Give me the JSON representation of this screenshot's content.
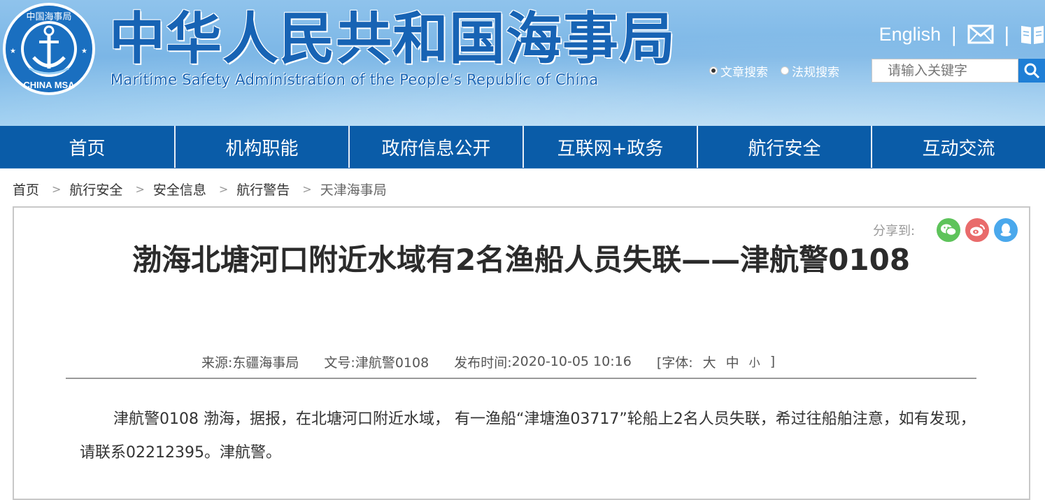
{
  "header": {
    "logo_text_top": "中国海事局",
    "logo_text_bottom": "CHINA MSA",
    "title_cn": "中华人民共和国海事局",
    "title_en": "Maritime Safety Administration of the People's Republic of China",
    "english_link": "English",
    "icons": [
      "mail-icon",
      "book-icon"
    ],
    "search_options": [
      {
        "label": "文章搜索",
        "selected": true
      },
      {
        "label": "法规搜索",
        "selected": false
      }
    ],
    "search_placeholder": "请输入关键字"
  },
  "nav": {
    "items": [
      "首页",
      "机构职能",
      "政府信息公开",
      "互联网+政务",
      "航行安全",
      "互动交流"
    ]
  },
  "breadcrumb": {
    "items": [
      "首页",
      "航行安全",
      "安全信息",
      "航行警告",
      "天津海事局"
    ],
    "separator": ">"
  },
  "article": {
    "share_label": "分享到:",
    "share_icons": [
      {
        "name": "wechat-icon",
        "color": "#5ec35b"
      },
      {
        "name": "weibo-icon",
        "color": "#e96b6b"
      },
      {
        "name": "qq-icon",
        "color": "#4aa8ec"
      }
    ],
    "title": "渤海北塘河口附近水域有2名渔船人员失联——津航警0108",
    "meta": {
      "source_label": "来源:",
      "source": "东疆海事局",
      "doc_label": "文号:",
      "doc_no": "津航警0108",
      "time_label": "发布时间:",
      "time": "2020-10-05 10:16",
      "font_label": "[字体:",
      "font_large": "大",
      "font_medium": "中",
      "font_small": "小",
      "font_close": "]"
    },
    "body": "津航警0108 渤海，据报，在北塘河口附近水域， 有一渔船“津塘渔03717”轮船上2名人员失联，希过往船舶注意，如有发现，请联系02212395。津航警。"
  },
  "colors": {
    "nav_bg": "#0a5ca8",
    "title_blue": "#1763b4",
    "search_button": "#1f7fd6"
  }
}
